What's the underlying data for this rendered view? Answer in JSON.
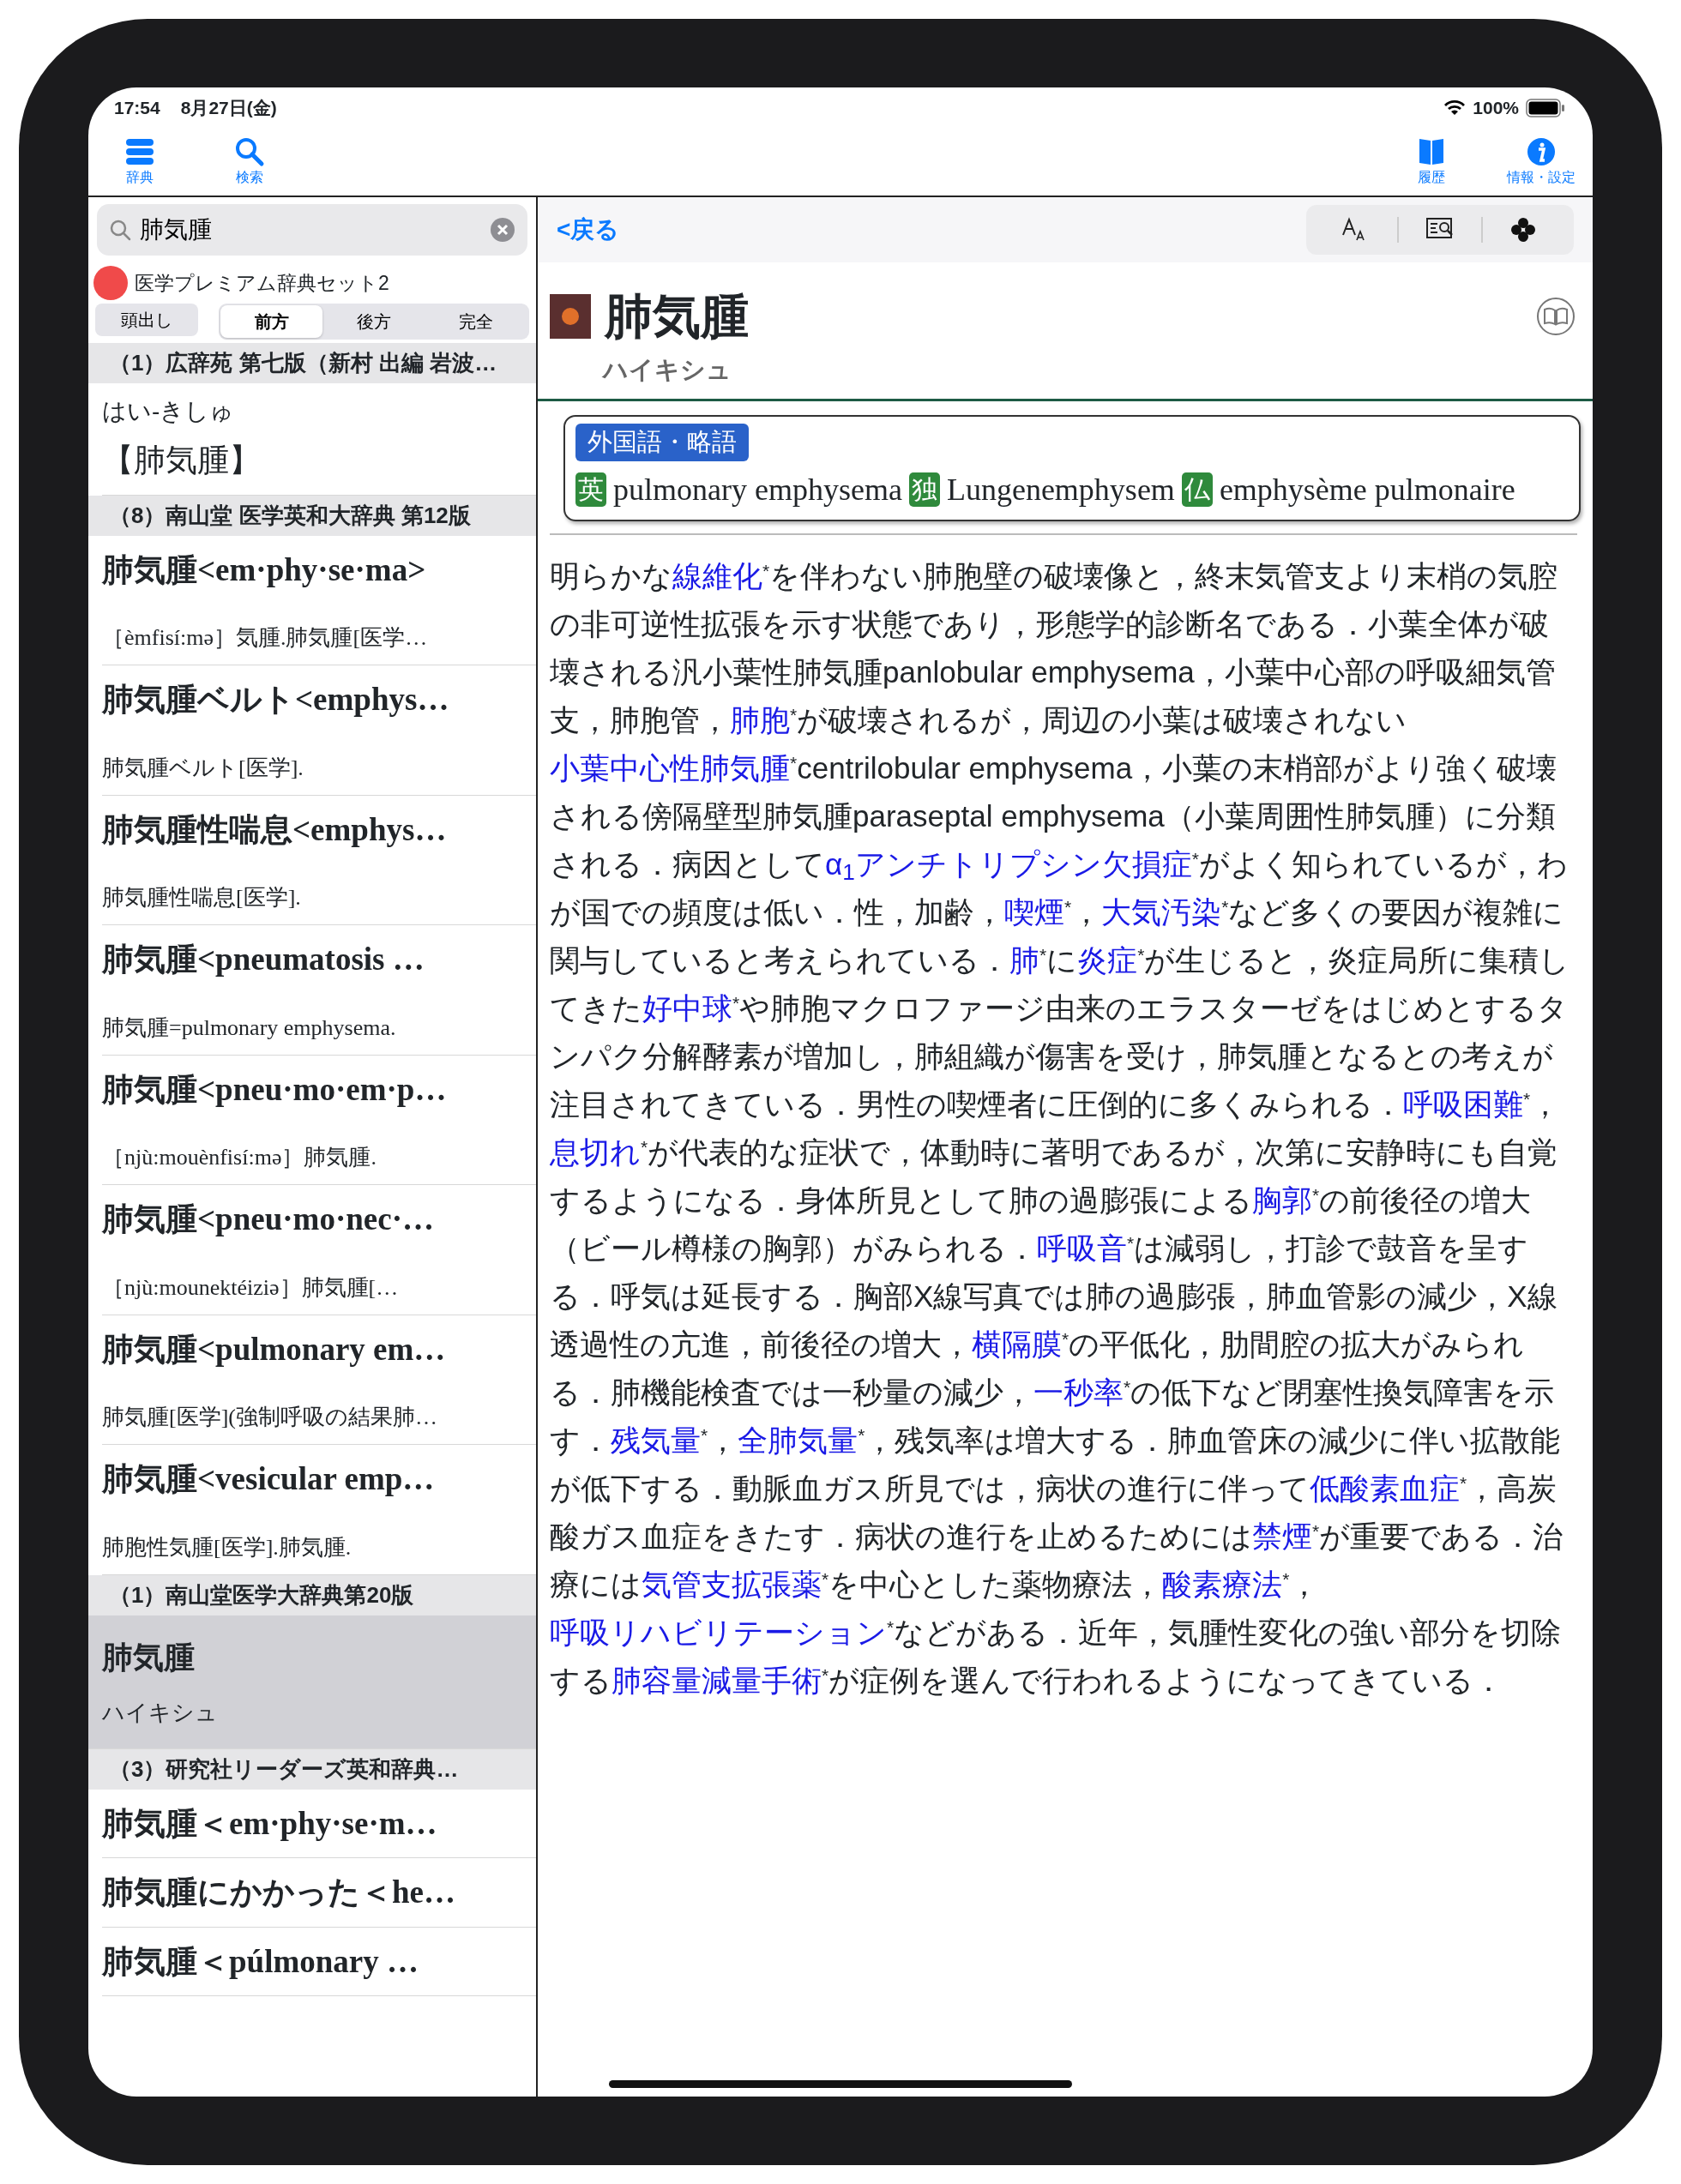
{
  "status_bar": {
    "time": "17:54",
    "date": "8月27日(金)",
    "battery": "100%"
  },
  "toolbar": {
    "left": [
      {
        "kind": "dictionary",
        "label": "辞典"
      },
      {
        "kind": "search",
        "label": "検索"
      }
    ],
    "right": [
      {
        "kind": "history",
        "label": "履歴"
      },
      {
        "kind": "info",
        "label": "情報・設定"
      }
    ]
  },
  "sidebar": {
    "search": {
      "value": "肺気腫"
    },
    "dictionary_set": "医学プレミアム辞典セット2",
    "modes": [
      {
        "label": "頭出し",
        "selected": false
      },
      {
        "label": "前方",
        "selected": true
      },
      {
        "label": "後方",
        "selected": false
      },
      {
        "label": "完全",
        "selected": false
      }
    ],
    "groups": [
      {
        "header": "（1）広辞苑 第七版（新村 出編 岩波…",
        "entries": [
          {
            "kind": "kana",
            "reading": "はい‐きしゅ",
            "headword": "【肺気腫】",
            "selected": false
          }
        ]
      },
      {
        "header": "（8）南山堂 医学英和大辞典 第12版",
        "entries": [
          {
            "kind": "serif",
            "headword": "肺気腫<em·phy·se·ma>",
            "gloss": "［èmfisí:mə］気腫.肺気腫[医学…",
            "selected": false
          },
          {
            "kind": "serif",
            "headword": "肺気腫ベルト<emphys…",
            "gloss": "肺気腫ベルト[医学].",
            "selected": false
          },
          {
            "kind": "serif",
            "headword": "肺気腫性喘息<emphys…",
            "gloss": "肺気腫性喘息[医学].",
            "selected": false
          },
          {
            "kind": "serif",
            "headword": "肺気腫<pneumatosis …",
            "gloss": "肺気腫=pulmonary emphysema.",
            "selected": false
          },
          {
            "kind": "serif",
            "headword": "肺気腫<pneu·mo·em·p…",
            "gloss": "［njù:mouènfisí:mə］肺気腫.",
            "selected": false
          },
          {
            "kind": "serif",
            "headword": "肺気腫<pneu·mo·nec·…",
            "gloss": "［njù:mounektéiziə］肺気腫[…",
            "selected": false
          },
          {
            "kind": "serif",
            "headword": "肺気腫<pulmonary em…",
            "gloss": "肺気腫[医学](強制呼吸の結果肺…",
            "selected": false
          },
          {
            "kind": "serif",
            "headword": "肺気腫<vesicular emp…",
            "gloss": "肺胞性気腫[医学].肺気腫.",
            "selected": false
          }
        ]
      },
      {
        "header": "（1）南山堂医学大辞典第20版",
        "entries": [
          {
            "kind": "sans",
            "headword": "肺気腫",
            "gloss": "ハイキシュ",
            "selected": true
          }
        ]
      },
      {
        "header": "（3）研究社リーダーズ英和辞典…",
        "entries": [
          {
            "kind": "serif",
            "headword": "肺気腫＜em·phy·se·m…",
            "selected": false
          },
          {
            "kind": "serif",
            "headword": "肺気腫にかかった＜he…",
            "selected": false
          },
          {
            "kind": "serif",
            "headword": "肺気腫＜púlmonary …",
            "selected": false
          }
        ]
      }
    ]
  },
  "content": {
    "back": "<戻る",
    "tools": [
      {
        "kind": "text-size"
      },
      {
        "kind": "find"
      },
      {
        "kind": "more"
      }
    ],
    "entry": {
      "headword": "肺気腫",
      "reading": "ハイキシュ"
    },
    "foreign": {
      "label": "外国語・略語",
      "terms": [
        {
          "lang": "英",
          "term": "pulmonary emphysema"
        },
        {
          "lang": "独",
          "term": "Lungenemphysem"
        },
        {
          "lang": "仏",
          "term": "emphysème pulmonaire"
        }
      ]
    },
    "body": [
      {
        "kind": "text",
        "text": "明らかな"
      },
      {
        "kind": "link",
        "text": "線維化"
      },
      {
        "kind": "text",
        "text": "$^{*}$を伴わない肺胞壁の破壊像と，終末気管支より末梢の気腔の非可逆性拡張を示す状態であり，形態学的診断名である．小葉全体が破壊される汎小葉性肺気腫panlobular emphysema，小葉中心部の呼吸細気管支，肺胞管，"
      },
      {
        "kind": "link",
        "text": "肺胞"
      },
      {
        "kind": "text",
        "text": "$^{*}$が破壊されるが，周辺の小葉は破壊されない"
      },
      {
        "kind": "link",
        "text": "小葉中心性肺気腫"
      },
      {
        "kind": "text",
        "text": "$^{*}$centrilobular emphysema，小葉の末梢部がより強く破壊される傍隔壁型肺気腫paraseptal emphysema（小葉周囲性肺気腫）に分類される．病因として"
      },
      {
        "kind": "link",
        "text": "α$_{1}$アンチトリプシン欠損症"
      },
      {
        "kind": "text",
        "text": "$^{*}$がよく知られているが，わが国での頻度は低い．性，加齢，"
      },
      {
        "kind": "link",
        "text": "喫煙"
      },
      {
        "kind": "text",
        "text": "$^{*}$，"
      },
      {
        "kind": "link",
        "text": "大気汚染"
      },
      {
        "kind": "text",
        "text": "$^{*}$など多くの要因が複雑に関与していると考えられている．"
      },
      {
        "kind": "link",
        "text": "肺"
      },
      {
        "kind": "text",
        "text": "$^{*}$に"
      },
      {
        "kind": "link",
        "text": "炎症"
      },
      {
        "kind": "text",
        "text": "$^{*}$が生じると，炎症局所に集積してきた"
      },
      {
        "kind": "link",
        "text": "好中球"
      },
      {
        "kind": "text",
        "text": "$^{*}$や肺胞マクロファージ由来のエラスターゼをはじめとするタンパク分解酵素が増加し，肺組織が傷害を受け，肺気腫となるとの考えが注目されてきている．男性の喫煙者に圧倒的に多くみられる．"
      },
      {
        "kind": "link",
        "text": "呼吸困難"
      },
      {
        "kind": "text",
        "text": "$^{*}$，"
      },
      {
        "kind": "link",
        "text": "息切れ"
      },
      {
        "kind": "text",
        "text": "$^{*}$が代表的な症状で，体動時に著明であるが，次第に安静時にも自覚するようになる．身体所見として肺の過膨張による"
      },
      {
        "kind": "link",
        "text": "胸郭"
      },
      {
        "kind": "text",
        "text": "$^{*}$の前後径の増大（ビール樽様の胸郭）がみられる．"
      },
      {
        "kind": "link",
        "text": "呼吸音"
      },
      {
        "kind": "text",
        "text": "$^{*}$は減弱し，打診で鼓音を呈する．呼気は延長する．胸部X線写真では肺の過膨張，肺血管影の減少，X線透過性の亢進，前後径の増大，"
      },
      {
        "kind": "link",
        "text": "横隔膜"
      },
      {
        "kind": "text",
        "text": "$^{*}$の平低化，肋間腔の拡大がみられる．肺機能検査では一秒量の減少，"
      },
      {
        "kind": "link",
        "text": "一秒率"
      },
      {
        "kind": "text",
        "text": "$^{*}$の低下など閉塞性換気障害を示す．"
      },
      {
        "kind": "link",
        "text": "残気量"
      },
      {
        "kind": "text",
        "text": "$^{*}$，"
      },
      {
        "kind": "link",
        "text": "全肺気量"
      },
      {
        "kind": "text",
        "text": "$^{*}$，残気率は増大する．肺血管床の減少に伴い拡散能が低下する．動脈血ガス所見では，病状の進行に伴って"
      },
      {
        "kind": "link",
        "text": "低酸素血症"
      },
      {
        "kind": "text",
        "text": "$^{*}$，高炭酸ガス血症をきたす．病状の進行を止めるためには"
      },
      {
        "kind": "link",
        "text": "禁煙"
      },
      {
        "kind": "text",
        "text": "$^{*}$が重要である．治療には"
      },
      {
        "kind": "link",
        "text": "気管支拡張薬"
      },
      {
        "kind": "text",
        "text": "$^{*}$を中心とした薬物療法，"
      },
      {
        "kind": "link",
        "text": "酸素療法"
      },
      {
        "kind": "text",
        "text": "$^{*}$，"
      },
      {
        "kind": "link",
        "text": "呼吸リハビリテーション"
      },
      {
        "kind": "text",
        "text": "$^{*}$などがある．近年，気腫性変化の強い部分を切除する"
      },
      {
        "kind": "link",
        "text": "肺容量減量手術"
      },
      {
        "kind": "text",
        "text": "$^{*}$が症例を選んで行われるようになってきている．"
      }
    ]
  }
}
